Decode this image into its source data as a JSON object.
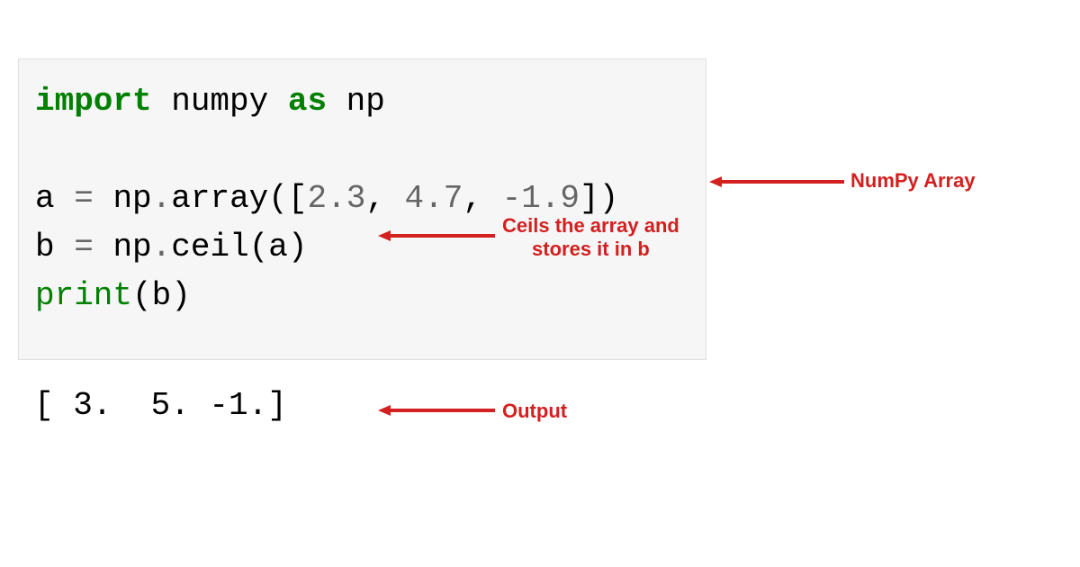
{
  "code": {
    "import_kw": "import",
    "module": " numpy ",
    "as_kw": "as",
    "alias": " np",
    "line_a_var": "a ",
    "line_a_eq": "= ",
    "line_a_np": "np",
    "line_a_dot1": ".",
    "line_a_array": "array",
    "line_a_lparen": "(",
    "line_a_lbracket": "[",
    "line_a_n1": "2.3",
    "line_a_c1": ", ",
    "line_a_n2": "4.7",
    "line_a_c2": ", ",
    "line_a_minus": "-",
    "line_a_n3": "1.9",
    "line_a_rbracket": "]",
    "line_a_rparen": ")",
    "line_b_var": "b ",
    "line_b_eq": "= ",
    "line_b_np": "np",
    "line_b_dot": ".",
    "line_b_ceil": "ceil",
    "line_b_lparen": "(",
    "line_b_arg": "a",
    "line_b_rparen": ")",
    "line_p_print": "print",
    "line_p_lparen": "(",
    "line_p_arg": "b",
    "line_p_rparen": ")"
  },
  "output": "[ 3.  5. -1.]",
  "annotations": {
    "numpy_array": "NumPy Array",
    "ceils_line1": "Ceils the array and",
    "ceils_line2": "stores it in b",
    "output": "Output"
  },
  "colors": {
    "arrow": "#d32020",
    "keyword": "#008000",
    "number": "#666666",
    "code_bg": "#f6f6f6"
  }
}
